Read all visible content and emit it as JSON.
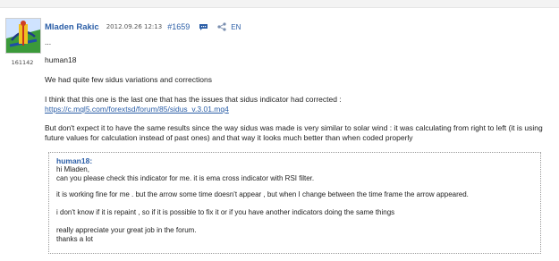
{
  "post": {
    "author": "Mladen Rakic",
    "date": "2012.09.26 12:13",
    "post_number": "#1659",
    "language": "EN",
    "user_id": "161142",
    "icons": {
      "translate": "chat-bubble-icon",
      "share": "share-icon"
    },
    "body": {
      "ellipsis": "...",
      "addressee": "human18",
      "p1": "We had quite few sidus variations and corrections",
      "p2_text": "I think that this one is the last one that has the issues that sidus indicator had corrected :",
      "p2_link": "https://c.mql5.com/forextsd/forum/85/sidus_v.3.01.mq4",
      "p3": "But don't expect it to have the same results since the way sidus was made is very similar to solar wind : it was calculating from right to left (it is using future values for calculation instead of past ones) and that way it looks much better than when coded properly"
    },
    "quote": {
      "author": "human18:",
      "line1": "hi Mladen,",
      "line2": "can you please check this indicator for me. it is ema cross indicator with RSI filter.",
      "line3": "it is working fine for me . but the arrow some time doesn't appear , but when I change between the time frame the arrow appeared.",
      "line4": "i don't know if it is repaint , so if it is possible to fix it or if you have another indicators doing the same things",
      "line5": "really appreciate your great job in the forum.",
      "line6": "thanks a lot"
    }
  },
  "colors": {
    "link": "#2b5ea7",
    "text": "#222222",
    "quote_border": "#9a9a9a"
  }
}
